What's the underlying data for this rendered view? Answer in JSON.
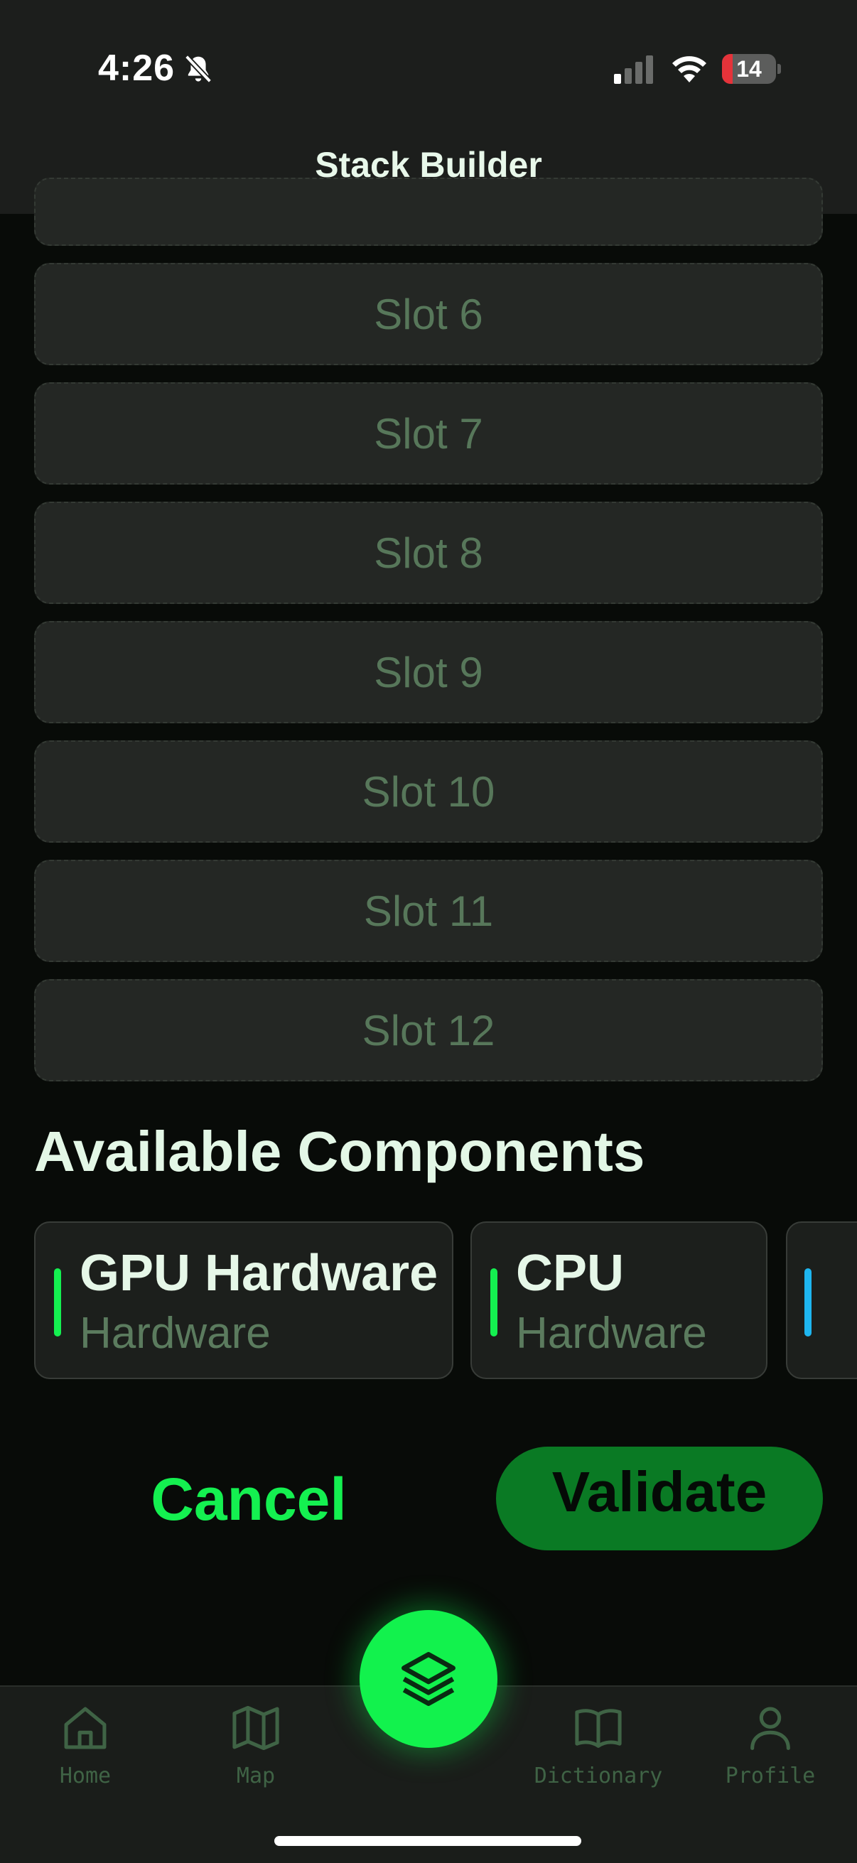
{
  "status_bar": {
    "time": "4:26",
    "battery": "14",
    "battery_level": 0.14
  },
  "header": {
    "title": "Stack Builder"
  },
  "slots": [
    "Slot 6",
    "Slot 7",
    "Slot 8",
    "Slot 9",
    "Slot 10",
    "Slot 11",
    "Slot 12"
  ],
  "available": {
    "title": "Available Components",
    "items": [
      {
        "name": "GPU Hardware",
        "category": "Hardware",
        "accent": "#14f050"
      },
      {
        "name": "CPU",
        "category": "Hardware",
        "accent": "#14f050"
      },
      {
        "name": "",
        "category": "",
        "accent": "#1eb6f0"
      }
    ]
  },
  "actions": {
    "cancel": "Cancel",
    "validate": "Validate"
  },
  "tabs": [
    {
      "label": "Home",
      "icon": "home-icon"
    },
    {
      "label": "Map",
      "icon": "map-icon"
    },
    {
      "label": "Dictionary",
      "icon": "book-icon"
    },
    {
      "label": "Profile",
      "icon": "person-icon"
    }
  ],
  "fab": {
    "icon": "layers-icon"
  },
  "colors": {
    "accent": "#14f050",
    "validate_bg": "#0a7a24",
    "tab_inactive": "#3f6345"
  }
}
